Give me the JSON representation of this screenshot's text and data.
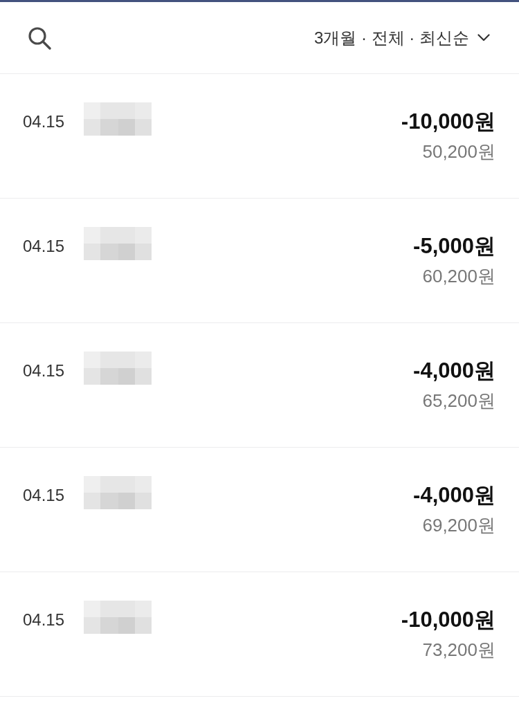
{
  "header": {
    "filter": {
      "label": "3개월 · 전체 · 최신순"
    }
  },
  "transactions": [
    {
      "date": "04.15",
      "amount": "-10,000원",
      "balance": "50,200원"
    },
    {
      "date": "04.15",
      "amount": "-5,000원",
      "balance": "60,200원"
    },
    {
      "date": "04.15",
      "amount": "-4,000원",
      "balance": "65,200원"
    },
    {
      "date": "04.15",
      "amount": "-4,000원",
      "balance": "69,200원"
    },
    {
      "date": "04.15",
      "amount": "-10,000원",
      "balance": "73,200원"
    }
  ]
}
